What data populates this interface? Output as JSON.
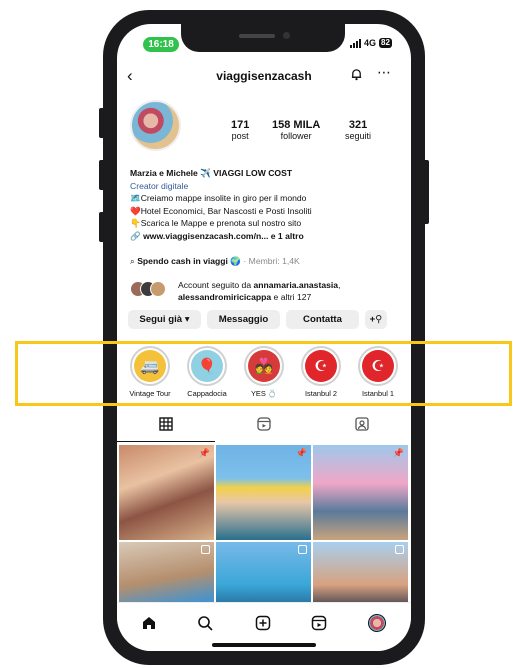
{
  "status": {
    "time": "16:18",
    "network": "4G",
    "battery": "82"
  },
  "header": {
    "username": "viaggisenzacash"
  },
  "stats": [
    {
      "value": "171",
      "label": "post"
    },
    {
      "value": "158 MILA",
      "label": "follower"
    },
    {
      "value": "321",
      "label": "seguiti"
    }
  ],
  "bio": {
    "name": "Marzia e Michele ✈️ VIAGGI LOW COST",
    "category": "Creator digitale",
    "line1": "🗺️Creiamo mappe insolite in giro per il mondo",
    "line2": "❤️Hotel Economici, Bar Nascosti e Posti Insoliti",
    "line3": "👇Scarica le Mappe e prenota sul nostro sito",
    "link": "www.viaggisenzacash.com/n... e 1 altro"
  },
  "channel": {
    "title": "Spendo cash in viaggi 🌍",
    "members": "· Membri: 1,4K"
  },
  "followed_by": {
    "prefix": "Account seguito da ",
    "user1": "annamaria.anastasia",
    "sep": ",",
    "user2": "alessandromiricicappa",
    "suffix": " e altri 127"
  },
  "actions": {
    "following": "Segui già ▾",
    "message": "Messaggio",
    "contacts": "Contatta",
    "add_person": "+⚲"
  },
  "highlights": [
    {
      "label": "Vintage Tour",
      "icon": "🚐"
    },
    {
      "label": "Cappadocia",
      "icon": "🎈"
    },
    {
      "label": "YES 💍",
      "icon": "💑"
    },
    {
      "label": "Istanbul 2",
      "icon": "☪"
    },
    {
      "label": "Istanbul 1",
      "icon": "☪"
    }
  ],
  "colors": {
    "accent_link": "#385898",
    "highlight_frame": "#f7c71a",
    "time_pill": "#30c24a"
  }
}
